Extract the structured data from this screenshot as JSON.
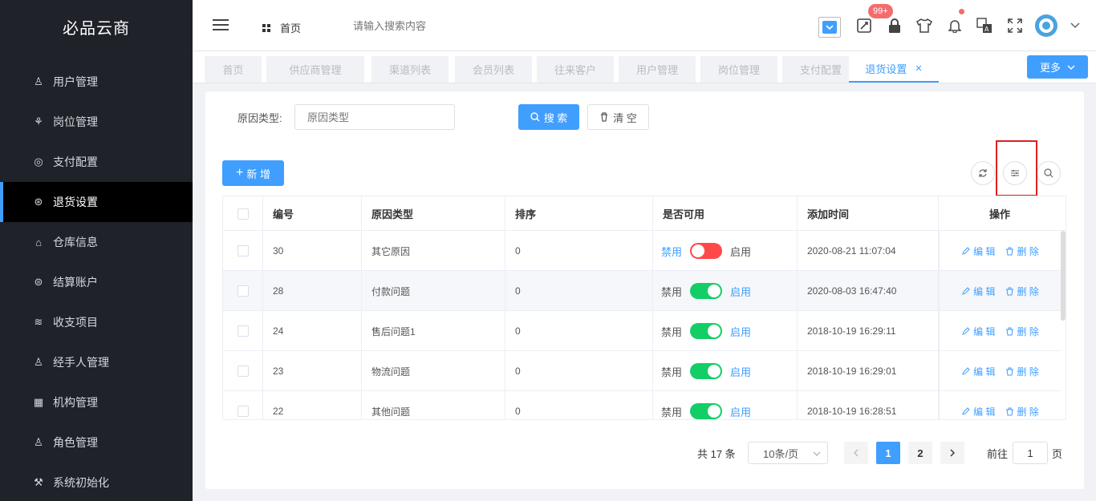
{
  "app": {
    "title": "必品云商"
  },
  "sidebar": {
    "items": [
      {
        "label": "用户管理",
        "icon": "user-icon"
      },
      {
        "label": "岗位管理",
        "icon": "org-icon"
      },
      {
        "label": "支付配置",
        "icon": "coins-icon"
      },
      {
        "label": "退货设置",
        "icon": "return-icon",
        "active": true
      },
      {
        "label": "仓库信息",
        "icon": "warehouse-icon"
      },
      {
        "label": "结算账户",
        "icon": "account-icon"
      },
      {
        "label": "收支项目",
        "icon": "layers-icon"
      },
      {
        "label": "经手人管理",
        "icon": "handler-icon"
      },
      {
        "label": "机构管理",
        "icon": "building-icon"
      },
      {
        "label": "角色管理",
        "icon": "role-icon"
      },
      {
        "label": "系统初始化",
        "icon": "wrench-icon"
      }
    ]
  },
  "header": {
    "home": "首页",
    "search_placeholder": "请输入搜索内容",
    "badge": "99+"
  },
  "tabs": [
    "首页",
    "供应商管理",
    "渠道列表",
    "会员列表",
    "往来客户",
    "用户管理",
    "岗位管理",
    "支付配置",
    "退货设置"
  ],
  "more": "更多",
  "filter": {
    "label": "原因类型:",
    "placeholder": "原因类型",
    "search": "搜 索",
    "clear": "清 空"
  },
  "add_button": "新 增",
  "table": {
    "columns": [
      "编号",
      "原因类型",
      "排序",
      "是否可用",
      "添加时间",
      "操作"
    ],
    "rows": [
      {
        "id": "30",
        "type": "其它原因",
        "order": "0",
        "enabled": false,
        "time": "2020-08-21 11:07:04"
      },
      {
        "id": "28",
        "type": "付款问题",
        "order": "0",
        "enabled": true,
        "time": "2020-08-03 16:47:40"
      },
      {
        "id": "24",
        "type": "售后问题1",
        "order": "0",
        "enabled": true,
        "time": "2018-10-19 16:29:11"
      },
      {
        "id": "23",
        "type": "物流问题",
        "order": "0",
        "enabled": true,
        "time": "2018-10-19 16:29:01"
      },
      {
        "id": "22",
        "type": "其他问题",
        "order": "0",
        "enabled": true,
        "time": "2018-10-19 16:28:51"
      }
    ],
    "disable_label": "禁用",
    "enable_label": "启用",
    "edit_label": "编 辑",
    "delete_label": "删 除"
  },
  "pagination": {
    "total": "共 17 条",
    "page_size": "10条/页",
    "pages": [
      "1",
      "2"
    ],
    "goto_label": "前往",
    "goto_value": "1",
    "page_suffix": "页"
  },
  "colors": {
    "primary": "#409eff",
    "sidebar_bg": "#1f2229",
    "switch_on": "#13ce66",
    "switch_off": "#ff4949",
    "highlight_box": "#e02020"
  }
}
